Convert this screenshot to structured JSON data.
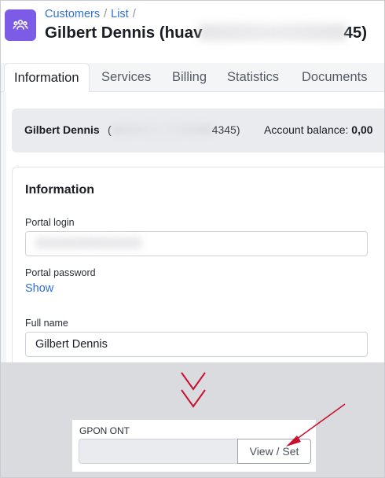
{
  "breadcrumb": {
    "items": [
      "Customers",
      "List"
    ],
    "separator": "/"
  },
  "header": {
    "title_start": "Gilbert Dennis (huav",
    "title_end": "45)"
  },
  "tabs": [
    {
      "label": "Information",
      "active": true
    },
    {
      "label": "Services",
      "active": false
    },
    {
      "label": "Billing",
      "active": false
    },
    {
      "label": "Statistics",
      "active": false
    },
    {
      "label": "Documents",
      "active": false
    }
  ],
  "summary": {
    "name": "Gilbert Dennis",
    "id_open": "(",
    "id_tail": "4345)",
    "balance_label": "Account balance:",
    "balance_value": "0,00"
  },
  "information": {
    "title": "Information",
    "portal_login_label": "Portal login",
    "portal_password_label": "Portal password",
    "show_label": "Show",
    "full_name_label": "Full name",
    "full_name_value": "Gilbert Dennis"
  },
  "gpon": {
    "label": "GPON ONT",
    "button_label": "View / Set"
  },
  "colors": {
    "accent": "#7c5ce7",
    "link": "#2f6fd6",
    "annotation": "#c8102e"
  },
  "icons": {
    "app": "customers-group-icon",
    "down": "double-chevron-down-icon",
    "pointer": "red-arrow-icon"
  }
}
